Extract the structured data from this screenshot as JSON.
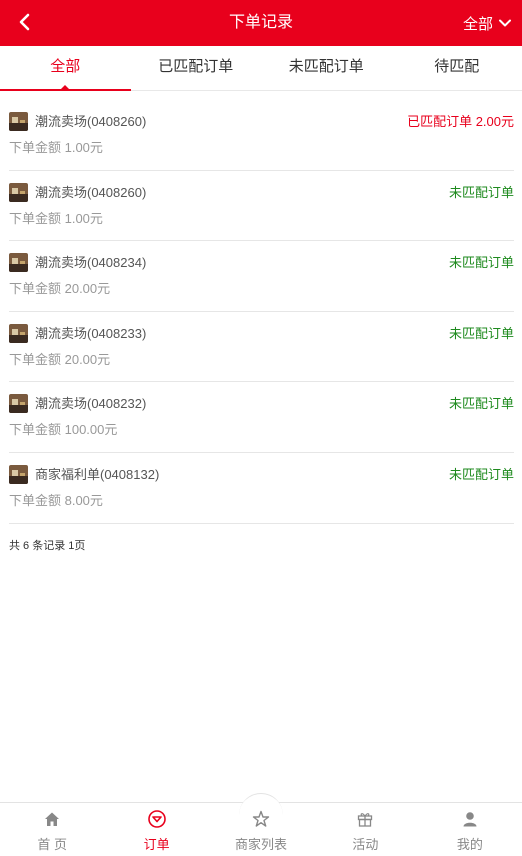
{
  "header": {
    "title": "下单记录",
    "filter_label": "全部"
  },
  "tabs": [
    {
      "label": "全部",
      "active": true
    },
    {
      "label": "已匹配订单",
      "active": false
    },
    {
      "label": "未匹配订单",
      "active": false
    },
    {
      "label": "待匹配",
      "active": false
    }
  ],
  "orders": [
    {
      "name": "潮流卖场(0408260)",
      "status": "已匹配订单 2.00元",
      "status_type": "matched",
      "amount": "下单金额 1.00元"
    },
    {
      "name": "潮流卖场(0408260)",
      "status": "未匹配订单",
      "status_type": "unmatched",
      "amount": "下单金额 1.00元"
    },
    {
      "name": "潮流卖场(0408234)",
      "status": "未匹配订单",
      "status_type": "unmatched",
      "amount": "下单金额 20.00元"
    },
    {
      "name": "潮流卖场(0408233)",
      "status": "未匹配订单",
      "status_type": "unmatched",
      "amount": "下单金额 20.00元"
    },
    {
      "name": "潮流卖场(0408232)",
      "status": "未匹配订单",
      "status_type": "unmatched",
      "amount": "下单金额 100.00元"
    },
    {
      "name": "商家福利单(0408132)",
      "status": "未匹配订单",
      "status_type": "unmatched",
      "amount": "下单金额 8.00元"
    }
  ],
  "summary": "共 6 条记录 1页",
  "bottom_nav": [
    {
      "label": "首 页",
      "icon": "home-icon",
      "active": false
    },
    {
      "label": "订单",
      "icon": "order-icon",
      "active": true
    },
    {
      "label": "商家列表",
      "icon": "star-icon",
      "active": false
    },
    {
      "label": "活动",
      "icon": "gift-icon",
      "active": false
    },
    {
      "label": "我的",
      "icon": "user-icon",
      "active": false
    }
  ],
  "colors": {
    "brand": "#e8001c",
    "matched": "#e8001c",
    "unmatched": "#1e8a1e"
  }
}
